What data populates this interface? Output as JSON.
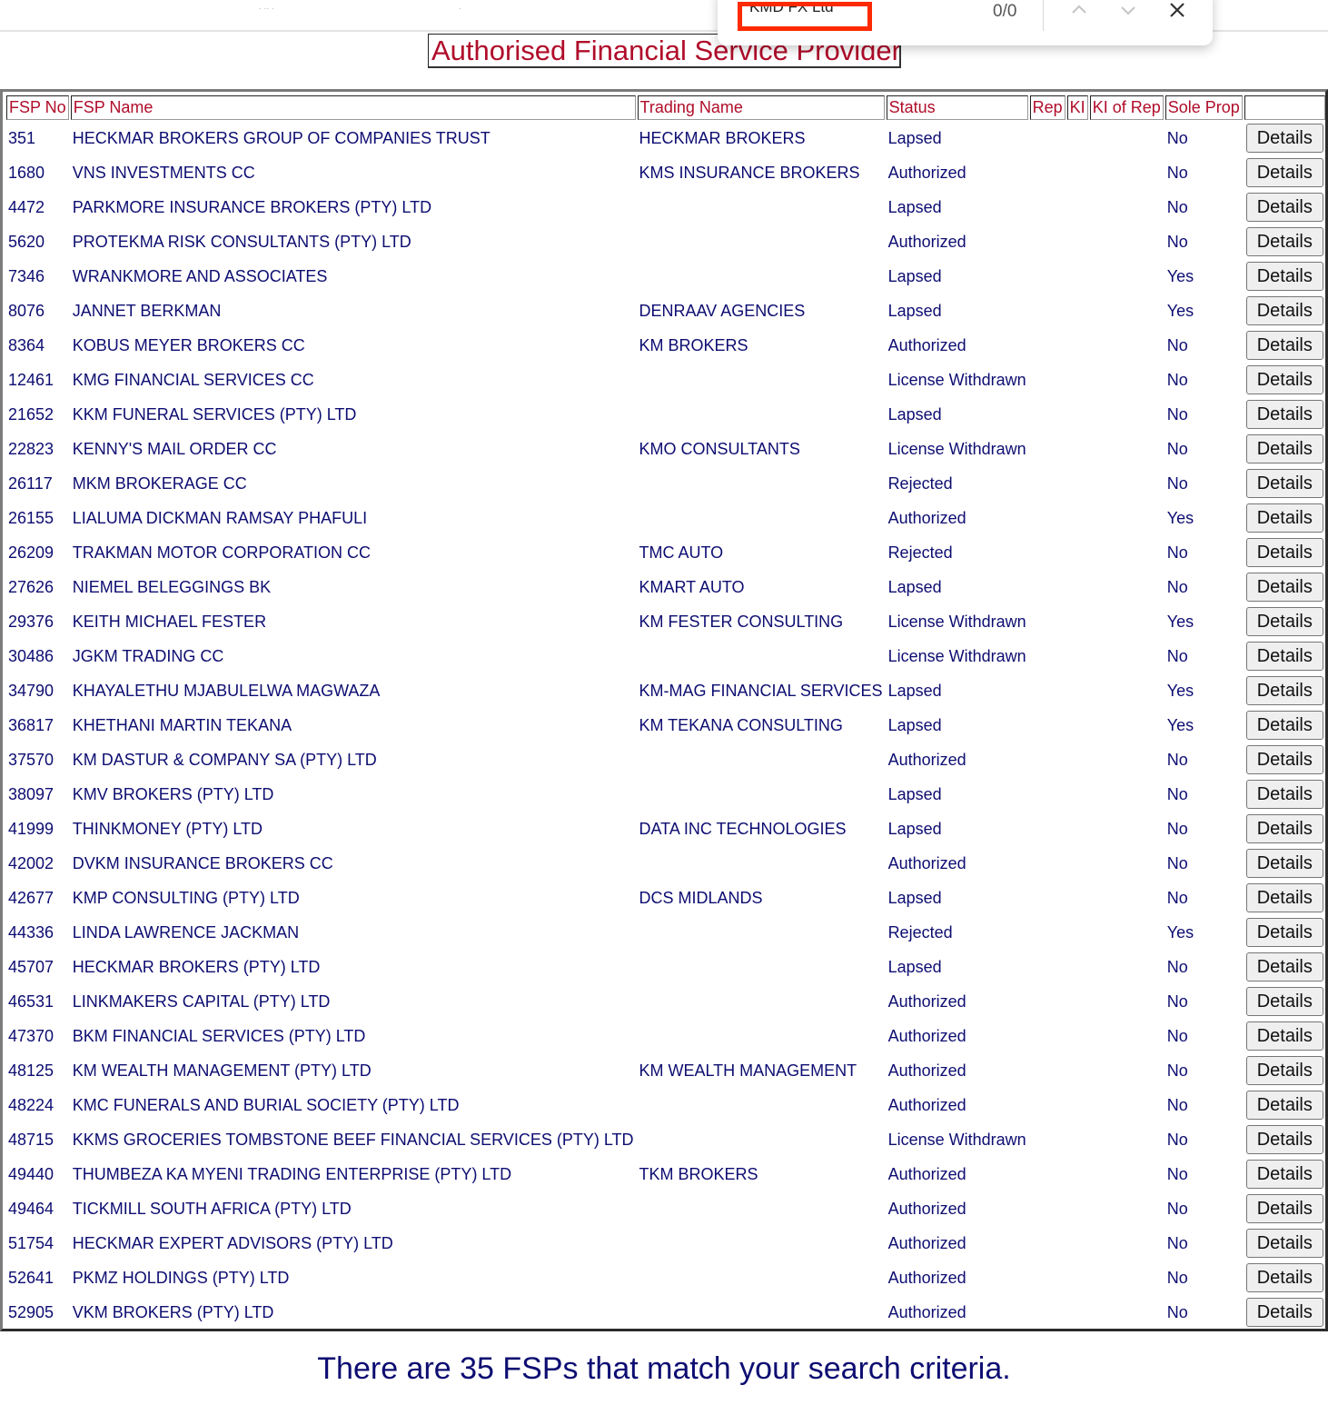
{
  "browser": {
    "find_bar": {
      "query": "KMD FX Ltd",
      "match_count": "0/0",
      "prev_icon": "chevron-up-icon",
      "next_icon": "chevron-down-icon",
      "close_icon": "close-icon"
    }
  },
  "page": {
    "title": "Authorised Financial Service Providers",
    "summary": "There are 35 FSPs that match your search criteria.",
    "colors": {
      "header_text": "#b00d2a",
      "body_text": "#0d0d72",
      "find_highlight": "#ff2a00"
    }
  },
  "table": {
    "columns": [
      "FSP No",
      "FSP Name",
      "Trading Name",
      "Status",
      "Rep",
      "KI",
      "KI of Rep",
      "Sole Prop",
      ""
    ],
    "button_label": "Details",
    "rows": [
      {
        "fsp_no": "351",
        "name": "HECKMAR BROKERS GROUP OF COMPANIES TRUST",
        "trading": "HECKMAR BROKERS",
        "status": "Lapsed",
        "rep": "",
        "ki": "",
        "ki_of_rep": "",
        "sole_prop": "No"
      },
      {
        "fsp_no": "1680",
        "name": "VNS INVESTMENTS CC",
        "trading": "KMS INSURANCE BROKERS",
        "status": "Authorized",
        "rep": "",
        "ki": "",
        "ki_of_rep": "",
        "sole_prop": "No"
      },
      {
        "fsp_no": "4472",
        "name": "PARKMORE INSURANCE BROKERS (PTY) LTD",
        "trading": "",
        "status": "Lapsed",
        "rep": "",
        "ki": "",
        "ki_of_rep": "",
        "sole_prop": "No"
      },
      {
        "fsp_no": "5620",
        "name": "PROTEKMA RISK CONSULTANTS (PTY) LTD",
        "trading": "",
        "status": "Authorized",
        "rep": "",
        "ki": "",
        "ki_of_rep": "",
        "sole_prop": "No"
      },
      {
        "fsp_no": "7346",
        "name": "WRANKMORE AND ASSOCIATES",
        "trading": "",
        "status": "Lapsed",
        "rep": "",
        "ki": "",
        "ki_of_rep": "",
        "sole_prop": "Yes"
      },
      {
        "fsp_no": "8076",
        "name": "JANNET BERKMAN",
        "trading": "DENRAAV AGENCIES",
        "status": "Lapsed",
        "rep": "",
        "ki": "",
        "ki_of_rep": "",
        "sole_prop": "Yes"
      },
      {
        "fsp_no": "8364",
        "name": "KOBUS MEYER BROKERS CC",
        "trading": "KM BROKERS",
        "status": "Authorized",
        "rep": "",
        "ki": "",
        "ki_of_rep": "",
        "sole_prop": "No"
      },
      {
        "fsp_no": "12461",
        "name": "KMG FINANCIAL SERVICES CC",
        "trading": "",
        "status": "License Withdrawn",
        "rep": "",
        "ki": "",
        "ki_of_rep": "",
        "sole_prop": "No"
      },
      {
        "fsp_no": "21652",
        "name": "KKM FUNERAL SERVICES (PTY) LTD",
        "trading": "",
        "status": "Lapsed",
        "rep": "",
        "ki": "",
        "ki_of_rep": "",
        "sole_prop": "No"
      },
      {
        "fsp_no": "22823",
        "name": "KENNY'S MAIL ORDER CC",
        "trading": "KMO CONSULTANTS",
        "status": "License Withdrawn",
        "rep": "",
        "ki": "",
        "ki_of_rep": "",
        "sole_prop": "No"
      },
      {
        "fsp_no": "26117",
        "name": "MKM BROKERAGE CC",
        "trading": "",
        "status": "Rejected",
        "rep": "",
        "ki": "",
        "ki_of_rep": "",
        "sole_prop": "No"
      },
      {
        "fsp_no": "26155",
        "name": "LIALUMA DICKMAN RAMSAY PHAFULI",
        "trading": "",
        "status": "Authorized",
        "rep": "",
        "ki": "",
        "ki_of_rep": "",
        "sole_prop": "Yes"
      },
      {
        "fsp_no": "26209",
        "name": "TRAKMAN MOTOR CORPORATION CC",
        "trading": "TMC AUTO",
        "status": "Rejected",
        "rep": "",
        "ki": "",
        "ki_of_rep": "",
        "sole_prop": "No"
      },
      {
        "fsp_no": "27626",
        "name": "NIEMEL BELEGGINGS BK",
        "trading": "KMART AUTO",
        "status": "Lapsed",
        "rep": "",
        "ki": "",
        "ki_of_rep": "",
        "sole_prop": "No"
      },
      {
        "fsp_no": "29376",
        "name": "KEITH MICHAEL FESTER",
        "trading": "KM FESTER CONSULTING",
        "status": "License Withdrawn",
        "rep": "",
        "ki": "",
        "ki_of_rep": "",
        "sole_prop": "Yes"
      },
      {
        "fsp_no": "30486",
        "name": "JGKM TRADING CC",
        "trading": "",
        "status": "License Withdrawn",
        "rep": "",
        "ki": "",
        "ki_of_rep": "",
        "sole_prop": "No"
      },
      {
        "fsp_no": "34790",
        "name": "KHAYALETHU MJABULELWA MAGWAZA",
        "trading": "KM-MAG FINANCIAL SERVICES",
        "status": "Lapsed",
        "rep": "",
        "ki": "",
        "ki_of_rep": "",
        "sole_prop": "Yes"
      },
      {
        "fsp_no": "36817",
        "name": "KHETHANI MARTIN TEKANA",
        "trading": "KM TEKANA CONSULTING",
        "status": "Lapsed",
        "rep": "",
        "ki": "",
        "ki_of_rep": "",
        "sole_prop": "Yes"
      },
      {
        "fsp_no": "37570",
        "name": "KM DASTUR & COMPANY SA (PTY) LTD",
        "trading": "",
        "status": "Authorized",
        "rep": "",
        "ki": "",
        "ki_of_rep": "",
        "sole_prop": "No"
      },
      {
        "fsp_no": "38097",
        "name": "KMV BROKERS (PTY) LTD",
        "trading": "",
        "status": "Lapsed",
        "rep": "",
        "ki": "",
        "ki_of_rep": "",
        "sole_prop": "No"
      },
      {
        "fsp_no": "41999",
        "name": "THINKMONEY (PTY) LTD",
        "trading": "DATA INC TECHNOLOGIES",
        "status": "Lapsed",
        "rep": "",
        "ki": "",
        "ki_of_rep": "",
        "sole_prop": "No"
      },
      {
        "fsp_no": "42002",
        "name": "DVKM INSURANCE BROKERS CC",
        "trading": "",
        "status": "Authorized",
        "rep": "",
        "ki": "",
        "ki_of_rep": "",
        "sole_prop": "No"
      },
      {
        "fsp_no": "42677",
        "name": "KMP CONSULTING (PTY) LTD",
        "trading": "DCS MIDLANDS",
        "status": "Lapsed",
        "rep": "",
        "ki": "",
        "ki_of_rep": "",
        "sole_prop": "No"
      },
      {
        "fsp_no": "44336",
        "name": "LINDA LAWRENCE JACKMAN",
        "trading": "",
        "status": "Rejected",
        "rep": "",
        "ki": "",
        "ki_of_rep": "",
        "sole_prop": "Yes"
      },
      {
        "fsp_no": "45707",
        "name": "HECKMAR BROKERS (PTY) LTD",
        "trading": "",
        "status": "Lapsed",
        "rep": "",
        "ki": "",
        "ki_of_rep": "",
        "sole_prop": "No"
      },
      {
        "fsp_no": "46531",
        "name": "LINKMAKERS CAPITAL (PTY) LTD",
        "trading": "",
        "status": "Authorized",
        "rep": "",
        "ki": "",
        "ki_of_rep": "",
        "sole_prop": "No"
      },
      {
        "fsp_no": "47370",
        "name": "BKM FINANCIAL SERVICES (PTY) LTD",
        "trading": "",
        "status": "Authorized",
        "rep": "",
        "ki": "",
        "ki_of_rep": "",
        "sole_prop": "No"
      },
      {
        "fsp_no": "48125",
        "name": "KM WEALTH MANAGEMENT (PTY) LTD",
        "trading": "KM WEALTH MANAGEMENT",
        "status": "Authorized",
        "rep": "",
        "ki": "",
        "ki_of_rep": "",
        "sole_prop": "No"
      },
      {
        "fsp_no": "48224",
        "name": "KMC FUNERALS AND BURIAL SOCIETY (PTY) LTD",
        "trading": "",
        "status": "Authorized",
        "rep": "",
        "ki": "",
        "ki_of_rep": "",
        "sole_prop": "No"
      },
      {
        "fsp_no": "48715",
        "name": "KKMS GROCERIES TOMBSTONE BEEF FINANCIAL SERVICES (PTY) LTD",
        "trading": "",
        "status": "License Withdrawn",
        "rep": "",
        "ki": "",
        "ki_of_rep": "",
        "sole_prop": "No"
      },
      {
        "fsp_no": "49440",
        "name": "THUMBEZA KA MYENI TRADING ENTERPRISE (PTY) LTD",
        "trading": "TKM BROKERS",
        "status": "Authorized",
        "rep": "",
        "ki": "",
        "ki_of_rep": "",
        "sole_prop": "No"
      },
      {
        "fsp_no": "49464",
        "name": "TICKMILL SOUTH AFRICA (PTY) LTD",
        "trading": "",
        "status": "Authorized",
        "rep": "",
        "ki": "",
        "ki_of_rep": "",
        "sole_prop": "No"
      },
      {
        "fsp_no": "51754",
        "name": "HECKMAR EXPERT ADVISORS (PTY) LTD",
        "trading": "",
        "status": "Authorized",
        "rep": "",
        "ki": "",
        "ki_of_rep": "",
        "sole_prop": "No"
      },
      {
        "fsp_no": "52641",
        "name": "PKMZ HOLDINGS (PTY) LTD",
        "trading": "",
        "status": "Authorized",
        "rep": "",
        "ki": "",
        "ki_of_rep": "",
        "sole_prop": "No"
      },
      {
        "fsp_no": "52905",
        "name": "VKM BROKERS (PTY) LTD",
        "trading": "",
        "status": "Authorized",
        "rep": "",
        "ki": "",
        "ki_of_rep": "",
        "sole_prop": "No"
      }
    ]
  }
}
